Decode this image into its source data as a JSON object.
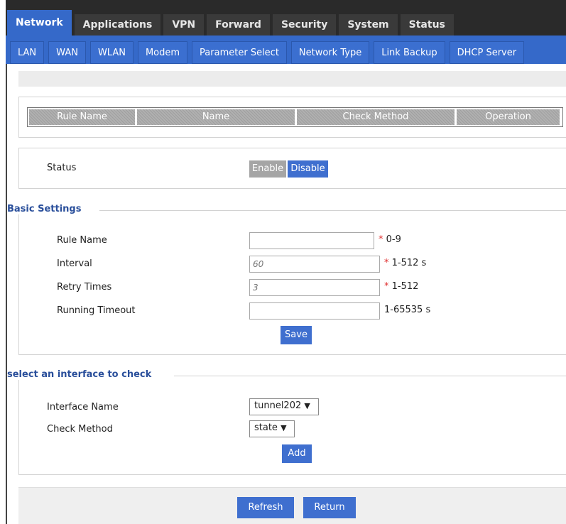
{
  "top_tabs": [
    "Network",
    "Applications",
    "VPN",
    "Forward",
    "Security",
    "System",
    "Status"
  ],
  "sub_tabs": [
    "LAN",
    "WAN",
    "WLAN",
    "Modem",
    "Parameter Select",
    "Network Type",
    "Link Backup",
    "DHCP Server"
  ],
  "rules_table": {
    "headers": [
      "Rule Name",
      "Name",
      "Check Method",
      "Operation"
    ]
  },
  "status": {
    "label": "Status",
    "enable": "Enable",
    "disable": "Disable"
  },
  "basic": {
    "title": "Basic Settings",
    "rule_name": {
      "label": "Rule Name",
      "value": "",
      "hint": "0-9"
    },
    "interval": {
      "label": "Interval",
      "placeholder": "60",
      "hint": "1-512 s"
    },
    "retry": {
      "label": "Retry Times",
      "placeholder": "3",
      "hint": "1-512"
    },
    "timeout": {
      "label": "Running Timeout",
      "value": "",
      "hint": "1-65535 s"
    },
    "required_mark": "*",
    "save": "Save"
  },
  "iface": {
    "title": "select an interface to check",
    "name_label": "Interface Name",
    "name_value": "tunnel202",
    "method_label": "Check Method",
    "method_value": "state",
    "dropdown_glyph": "▼",
    "add": "Add"
  },
  "footer": {
    "refresh": "Refresh",
    "return": "Return"
  },
  "colors": {
    "accent": "#3569c9",
    "button": "#3f6fcf",
    "required": "#e03030"
  }
}
